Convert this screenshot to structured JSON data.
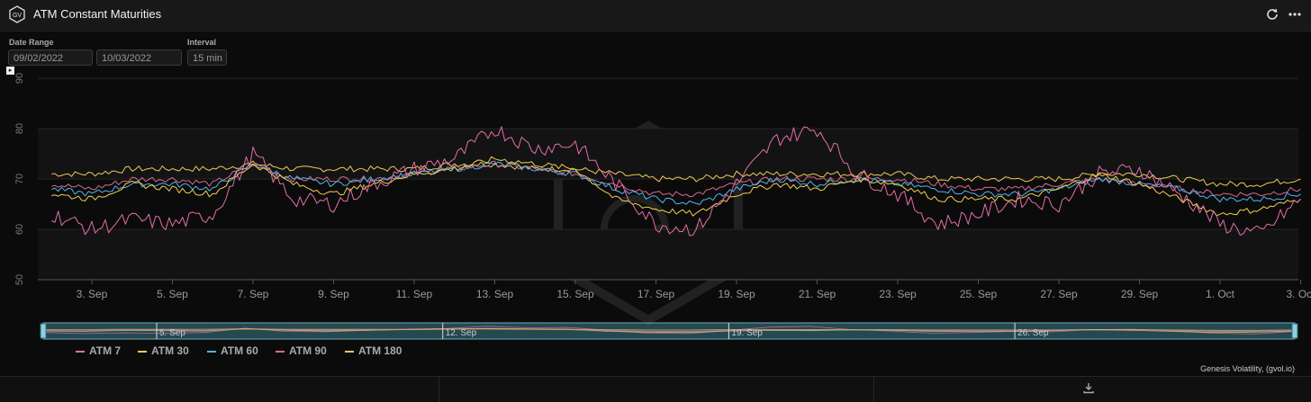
{
  "window": {
    "title": "ATM Constant Maturities",
    "logo_text": "GV",
    "refresh_icon": "refresh-icon",
    "more_icon": "more-icon"
  },
  "filters": {
    "date_range_label": "Date Range",
    "start_date": "09/02/2022",
    "end_date": "10/03/2022",
    "interval_label": "Interval",
    "interval_value": "15 min"
  },
  "credits": "Genesis Volatility, (gvol.io)",
  "footer": {
    "download_icon": "download-icon"
  },
  "colors": {
    "background": "#0b0b0b",
    "grid": "#2a2a2a",
    "axis_text": "#9a9a9a",
    "navigator_fill": "#3d7d8c"
  },
  "chart_data": {
    "type": "line",
    "title": "",
    "xlabel": "",
    "ylabel": "",
    "ylim": [
      50,
      90
    ],
    "yticks": [
      50,
      60,
      70,
      80,
      90
    ],
    "x_tick_labels": [
      "3. Sep",
      "5. Sep",
      "7. Sep",
      "9. Sep",
      "11. Sep",
      "13. Sep",
      "15. Sep",
      "17. Sep",
      "19. Sep",
      "21. Sep",
      "23. Sep",
      "25. Sep",
      "27. Sep",
      "29. Sep",
      "1. Oct",
      "3. Oct"
    ],
    "navigator_labels": [
      "5. Sep",
      "12. Sep",
      "19. Sep",
      "26. Sep"
    ],
    "legend_position": "bottom-left",
    "x": [
      "2022-09-02",
      "2022-09-03",
      "2022-09-04",
      "2022-09-05",
      "2022-09-06",
      "2022-09-07",
      "2022-09-08",
      "2022-09-09",
      "2022-09-10",
      "2022-09-11",
      "2022-09-12",
      "2022-09-13",
      "2022-09-14",
      "2022-09-15",
      "2022-09-16",
      "2022-09-17",
      "2022-09-18",
      "2022-09-19",
      "2022-09-20",
      "2022-09-21",
      "2022-09-22",
      "2022-09-23",
      "2022-09-24",
      "2022-09-25",
      "2022-09-26",
      "2022-09-27",
      "2022-09-28",
      "2022-09-29",
      "2022-09-30",
      "2022-10-01",
      "2022-10-02",
      "2022-10-03"
    ],
    "series": [
      {
        "name": "ATM 7",
        "color": "#e46fa8",
        "values": [
          63,
          60,
          62,
          61,
          63,
          75,
          66,
          65,
          69,
          72,
          74,
          80,
          76,
          77,
          69,
          61,
          60,
          69,
          78,
          80,
          71,
          67,
          61,
          63,
          66,
          65,
          71,
          72,
          67,
          61,
          59,
          66
        ]
      },
      {
        "name": "ATM 30",
        "color": "#f4d04a",
        "values": [
          67,
          66,
          69,
          68,
          67,
          73,
          69,
          67,
          69,
          71,
          72,
          74,
          73,
          72,
          66,
          64,
          63,
          67,
          69,
          68,
          70,
          69,
          66,
          66,
          66,
          68,
          71,
          69,
          66,
          63,
          64,
          66
        ]
      },
      {
        "name": "ATM 60",
        "color": "#4db7f2",
        "values": [
          68,
          67,
          69,
          69,
          68,
          73,
          70,
          69,
          70,
          71,
          72,
          73,
          72,
          71,
          68,
          66,
          65,
          68,
          70,
          69,
          70,
          69,
          68,
          67,
          67,
          68,
          70,
          69,
          68,
          66,
          66,
          67
        ]
      },
      {
        "name": "ATM 90",
        "color": "#d76a8e",
        "values": [
          69,
          68,
          70,
          70,
          69,
          73,
          70,
          70,
          70,
          71,
          72,
          73,
          72,
          71,
          69,
          67,
          67,
          69,
          70,
          70,
          70,
          70,
          69,
          68,
          68,
          69,
          70,
          69,
          68,
          67,
          67,
          68
        ]
      },
      {
        "name": "ATM 180",
        "color": "#f1c75a",
        "values": [
          71,
          71,
          72,
          72,
          72,
          73,
          72,
          72,
          72,
          72,
          73,
          73,
          72,
          72,
          71,
          70,
          70,
          71,
          71,
          71,
          71,
          71,
          70,
          70,
          70,
          70,
          71,
          71,
          70,
          69,
          69,
          70
        ]
      }
    ]
  }
}
